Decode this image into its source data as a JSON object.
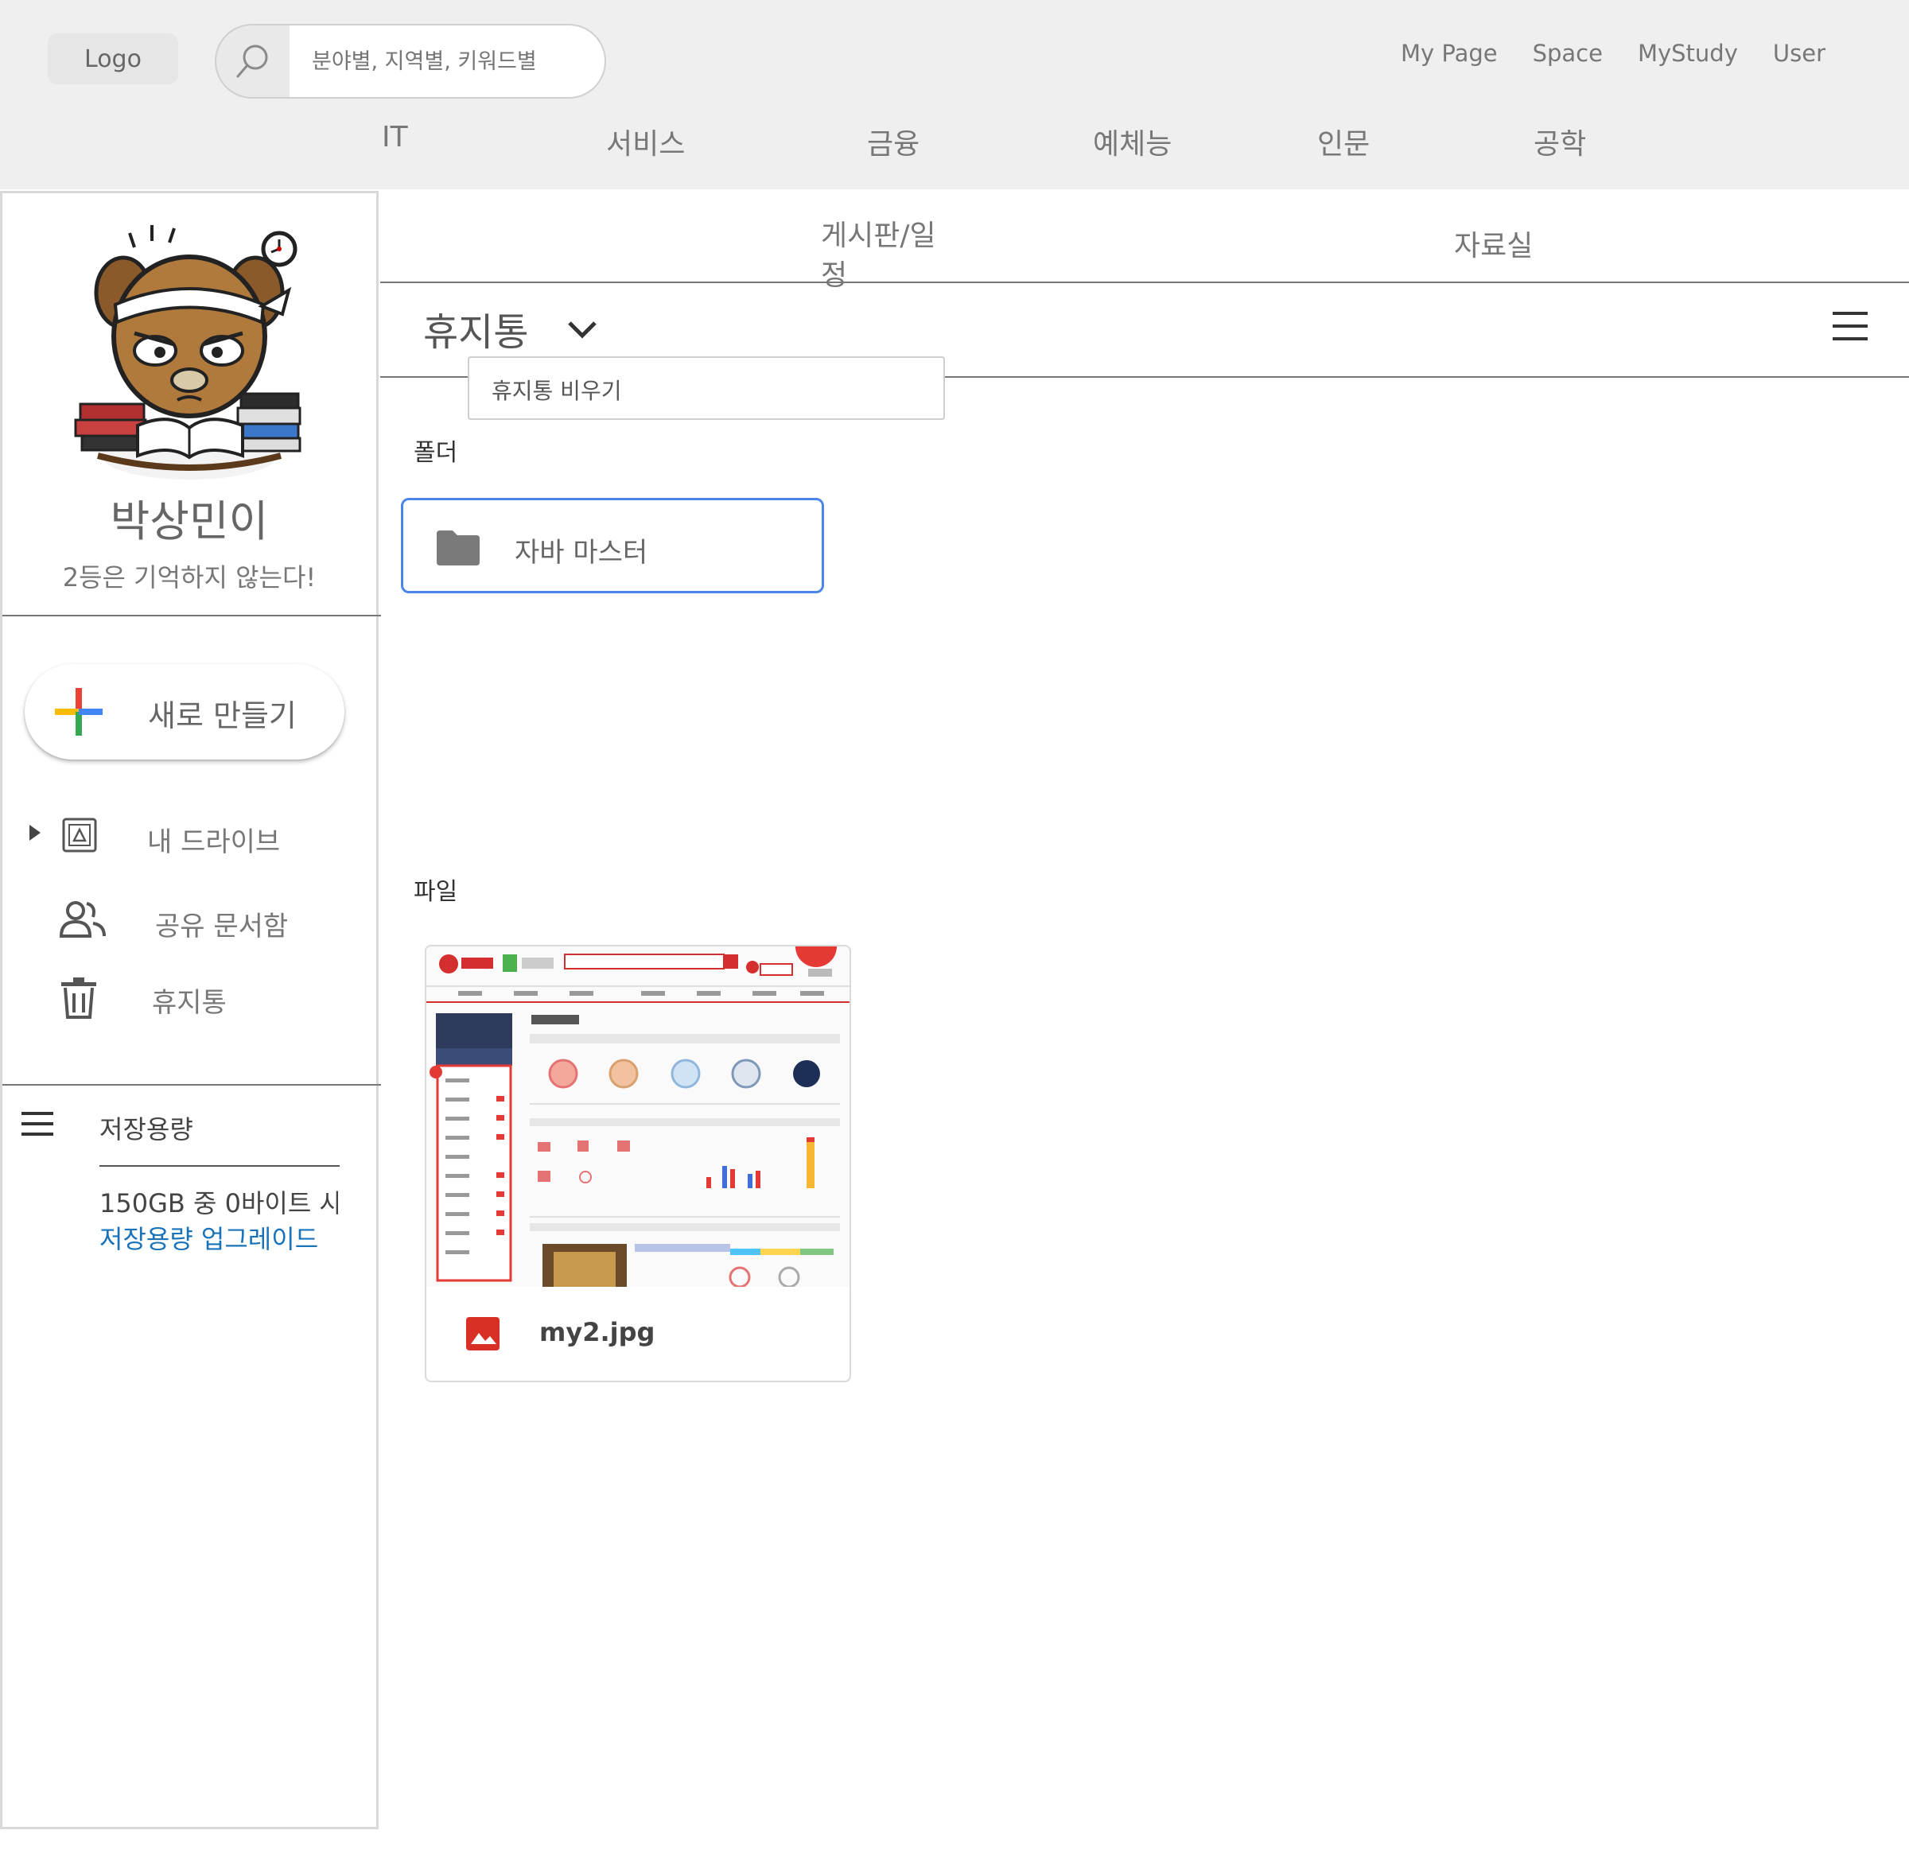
{
  "header": {
    "logo": "Logo",
    "search": {
      "placeholder": "분야별, 지역별, 키워드별"
    },
    "links": [
      "My Page",
      "Space",
      "MyStudy",
      "User"
    ],
    "categories": [
      "IT",
      "서비스",
      "금융",
      "예체능",
      "인문",
      "공학"
    ]
  },
  "sidebar": {
    "profile": {
      "name": "박상민이",
      "motto": "2등은 기억하지 않는다!"
    },
    "new_button": "새로 만들기",
    "nav": [
      {
        "label": "내 드라이브",
        "icon": "drive-icon"
      },
      {
        "label": "공유 문서함",
        "icon": "people-icon"
      },
      {
        "label": "휴지통",
        "icon": "trash-icon"
      }
    ],
    "storage": {
      "title": "저장용량",
      "usage": "150GB  중 0바이트 사",
      "upgrade": "저장용량 업그레이드"
    }
  },
  "main": {
    "tabs": [
      "게시판/일정",
      "자료실"
    ],
    "title": "휴지통",
    "dropdown": {
      "items": [
        "휴지통 비우기"
      ]
    },
    "sections": {
      "folders": "폴더",
      "files": "파일"
    },
    "folders": [
      {
        "name": "자바 마스터",
        "icon": "folder-icon"
      }
    ],
    "files": [
      {
        "name": "my2.jpg",
        "icon": "image-icon"
      }
    ]
  },
  "colors": {
    "header_bg": "#efefef",
    "accent_blue": "#4a86e8",
    "link_blue": "#1a73b8",
    "image_icon_red": "#d93025"
  }
}
